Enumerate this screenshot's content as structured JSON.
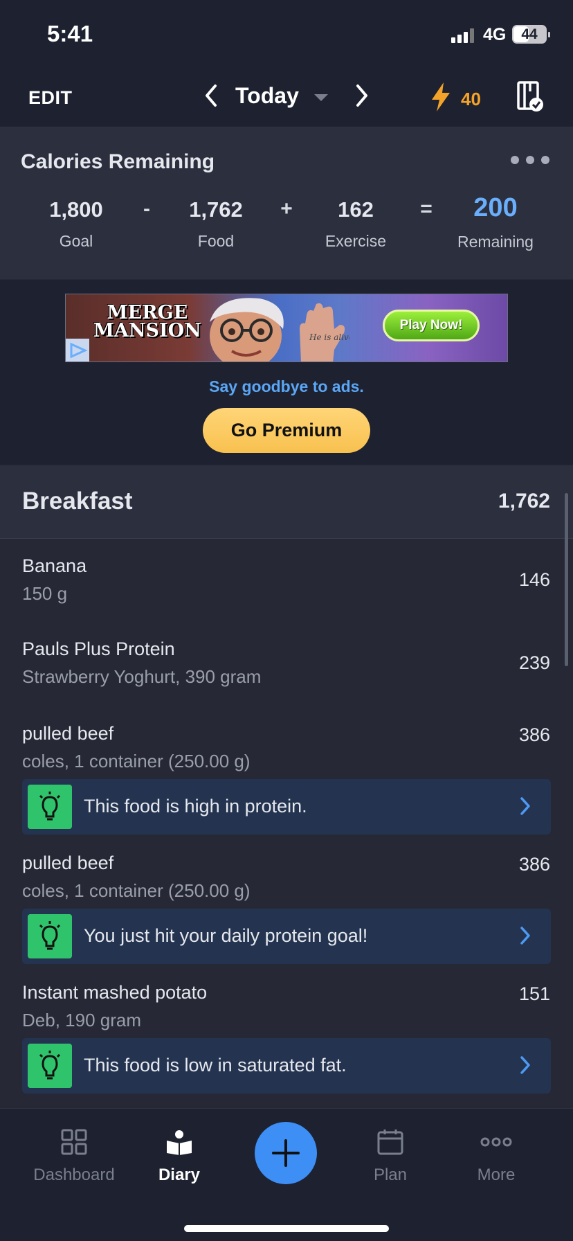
{
  "status": {
    "time": "5:41",
    "network": "4G",
    "battery": "44"
  },
  "header": {
    "edit": "EDIT",
    "date": "Today",
    "streak": "40"
  },
  "calories": {
    "title": "Calories Remaining",
    "goal": {
      "value": "1,800",
      "label": "Goal"
    },
    "op1": "-",
    "food": {
      "value": "1,762",
      "label": "Food"
    },
    "op2": "+",
    "exercise": {
      "value": "162",
      "label": "Exercise"
    },
    "op3": "=",
    "remaining": {
      "value": "200",
      "label": "Remaining"
    }
  },
  "ad": {
    "logo_line1": "MERGE",
    "logo_line2": "MANSION",
    "hand_text": "He is alive",
    "play_label": "Play Now!",
    "goodbye": "Say goodbye to ads.",
    "premium": "Go Premium"
  },
  "meal": {
    "title": "Breakfast",
    "total": "1,762",
    "items": [
      {
        "name": "Banana",
        "detail": "150 g",
        "calories": "146"
      },
      {
        "name": "Pauls Plus Protein",
        "detail": "Strawberry Yoghurt, 390 gram",
        "calories": "239"
      },
      {
        "name": "pulled beef",
        "detail": "coles, 1 container (250.00 g)",
        "calories": "386",
        "tip": "This food is high in protein."
      },
      {
        "name": "pulled beef",
        "detail": "coles, 1 container (250.00 g)",
        "calories": "386",
        "tip": "You just hit your daily protein goal!"
      },
      {
        "name": "Instant mashed potato",
        "detail": "Deb, 190 gram",
        "calories": "151",
        "tip": "This food is low in saturated fat."
      }
    ]
  },
  "tabs": [
    {
      "label": "Dashboard",
      "icon": "dashboard-icon"
    },
    {
      "label": "Diary",
      "icon": "diary-icon",
      "active": true
    },
    {
      "label": "Plan",
      "icon": "calendar-icon"
    },
    {
      "label": "More",
      "icon": "more-icon"
    }
  ],
  "colors": {
    "accent": "#3d8ef5",
    "remaining": "#6aaefc",
    "streak": "#f4a32a",
    "tip_icon": "#2fc46b",
    "premium": "#f8c14f"
  }
}
